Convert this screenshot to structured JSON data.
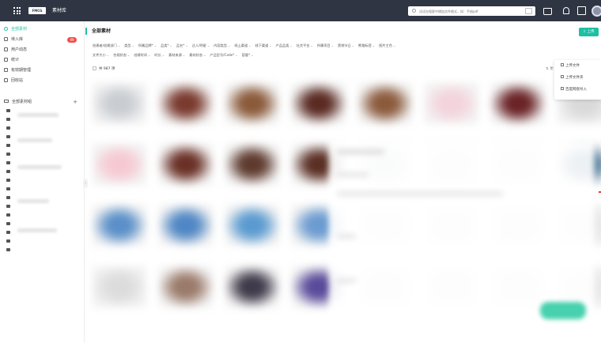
{
  "topbar": {
    "logo_text": "FMCG",
    "app_title": "素材库",
    "search_placeholder": "试试在搜索中增加文件格式，如：手册pdf",
    "icons": [
      "grid-icon",
      "search-icon",
      "image-search-icon",
      "bag-icon",
      "bell-icon",
      "box-icon",
      "avatar"
    ]
  },
  "sidebar": {
    "items": [
      {
        "label": "全部素材",
        "icon": "all-assets-icon",
        "active": true
      },
      {
        "label": "待入库",
        "icon": "inbox-icon",
        "badge": "99"
      },
      {
        "label": "用户动态",
        "icon": "activity-icon"
      },
      {
        "label": "统计",
        "icon": "chart-icon"
      },
      {
        "label": "有效期管理",
        "icon": "expiry-icon"
      },
      {
        "label": "回收站",
        "icon": "trash-icon"
      }
    ],
    "library": {
      "label": "全部素材组",
      "add": "+"
    },
    "collapse_glyph": "‹"
  },
  "main": {
    "title": "全部素材",
    "upload_label": "上传",
    "filters_row1": [
      "创建者/创建部门",
      "类型",
      "所属品牌*",
      "品类*",
      "品名*",
      "达人/明星",
      "内容类型",
      "线上渠道",
      "线下渠道",
      "产品品类",
      "社交平台",
      "所属项目",
      "营销节日",
      "熊猫标签",
      "图片主色"
    ],
    "filters_row2": [
      "文件大小",
      "合规状态",
      "创建时间",
      "时长",
      "素材来源",
      "素材状态",
      "产品型号/Code*",
      "容量*"
    ],
    "caret": "⌄",
    "result_count": "共 987 项",
    "view_toggle": "⇅ 更",
    "upload_menu": [
      "上传文件",
      "上传文件夹",
      "百度网盘导入"
    ]
  },
  "colors": {
    "accent": "#1fbfa3",
    "topbar": "#2f3542",
    "badge": "#f04e4e"
  }
}
